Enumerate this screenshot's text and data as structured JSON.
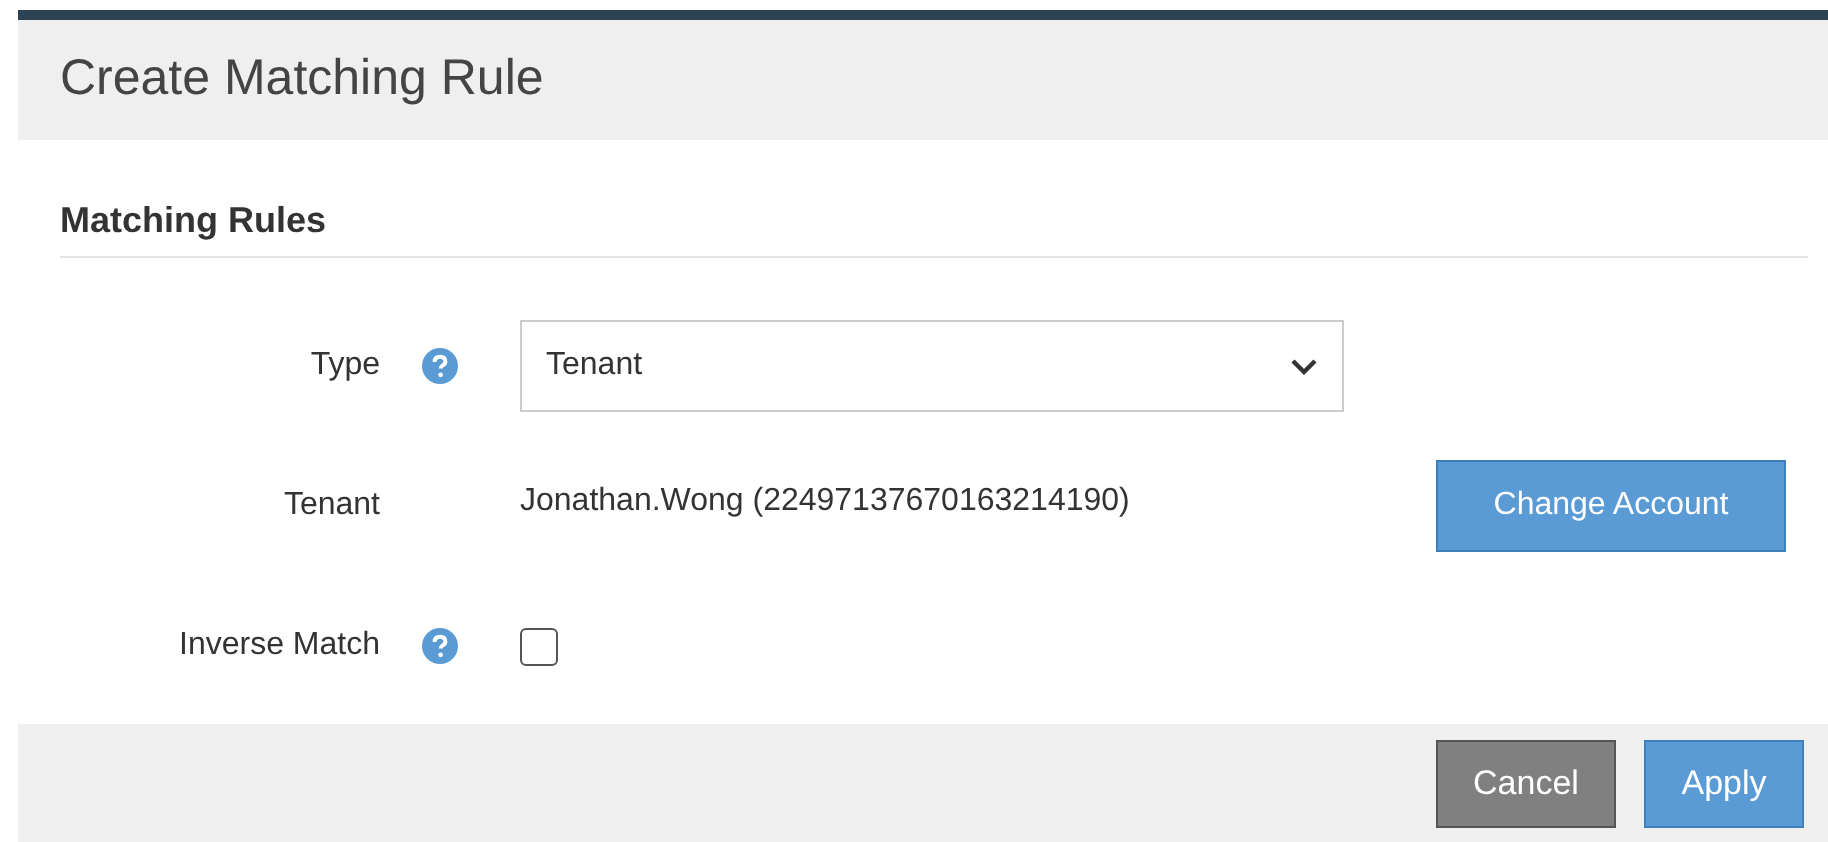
{
  "dialog": {
    "title": "Create Matching Rule"
  },
  "section": {
    "title": "Matching Rules"
  },
  "fields": [
    {
      "kind": "select",
      "label": "Type",
      "help": true,
      "value": "Tenant"
    },
    {
      "kind": "text",
      "label": "Tenant",
      "help": false,
      "value": "Jonathan.Wong (22497137670163214190)",
      "action": "Change Account"
    },
    {
      "kind": "checkbox",
      "label": "Inverse Match",
      "help": true,
      "checked": false
    }
  ],
  "buttons": [
    {
      "label": "Cancel",
      "kind": "secondary"
    },
    {
      "label": "Apply",
      "kind": "primary"
    }
  ]
}
